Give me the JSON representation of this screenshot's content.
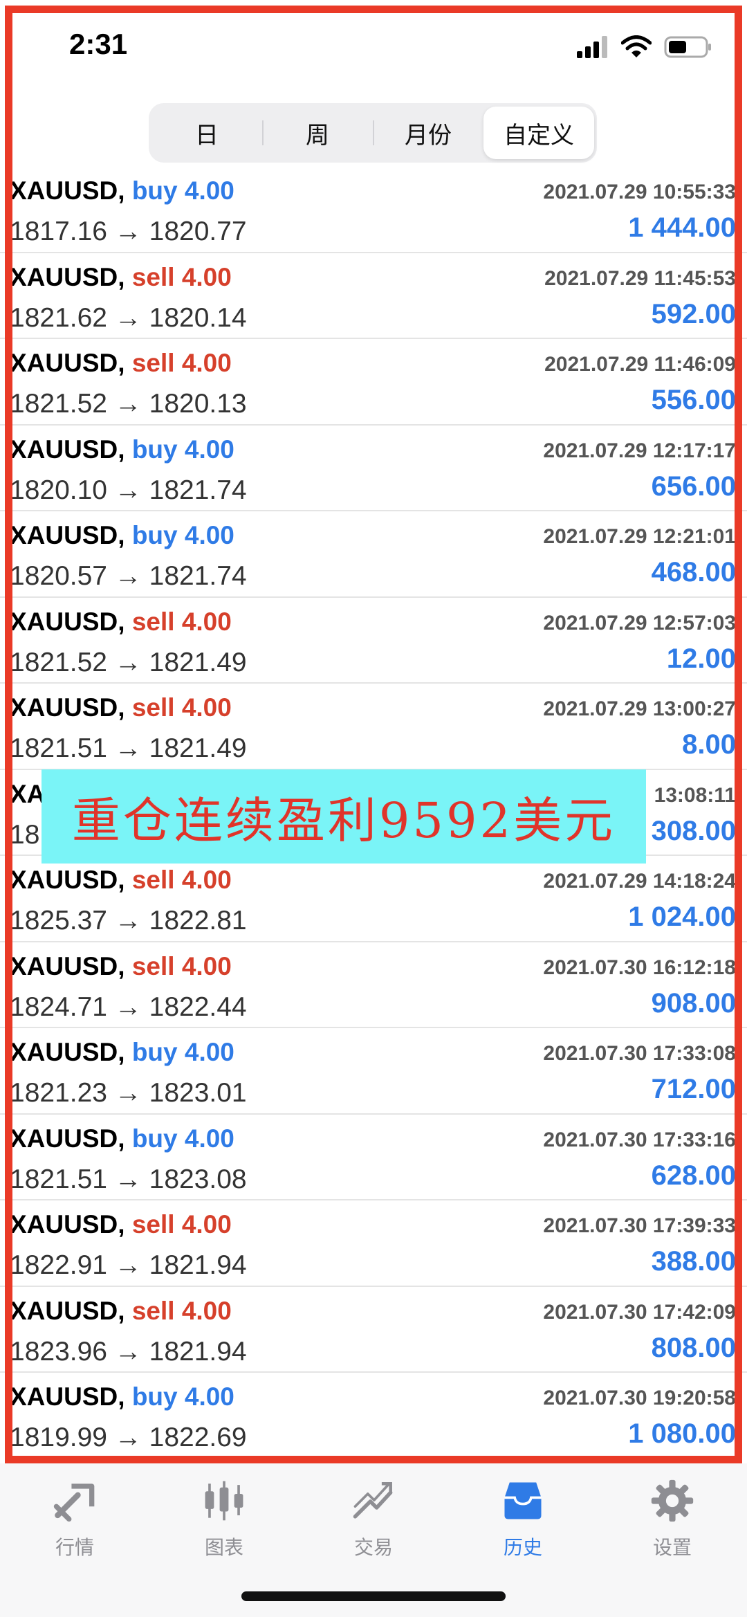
{
  "status": {
    "time": "2:31"
  },
  "segments": [
    {
      "label": "日",
      "active": false
    },
    {
      "label": "周",
      "active": false
    },
    {
      "label": "月份",
      "active": false
    },
    {
      "label": "自定义",
      "active": true
    }
  ],
  "trades": [
    {
      "symbol": "XAUUSD",
      "side": "buy",
      "volume": "4.00",
      "prices": "1817.16 → 1820.77",
      "time": "2021.07.29 10:55:33",
      "profit": "1 444.00"
    },
    {
      "symbol": "XAUUSD",
      "side": "sell",
      "volume": "4.00",
      "prices": "1821.62 → 1820.14",
      "time": "2021.07.29 11:45:53",
      "profit": "592.00"
    },
    {
      "symbol": "XAUUSD",
      "side": "sell",
      "volume": "4.00",
      "prices": "1821.52 → 1820.13",
      "time": "2021.07.29 11:46:09",
      "profit": "556.00"
    },
    {
      "symbol": "XAUUSD",
      "side": "buy",
      "volume": "4.00",
      "prices": "1820.10 → 1821.74",
      "time": "2021.07.29 12:17:17",
      "profit": "656.00"
    },
    {
      "symbol": "XAUUSD",
      "side": "buy",
      "volume": "4.00",
      "prices": "1820.57 → 1821.74",
      "time": "2021.07.29 12:21:01",
      "profit": "468.00"
    },
    {
      "symbol": "XAUUSD",
      "side": "sell",
      "volume": "4.00",
      "prices": "1821.52 → 1821.49",
      "time": "2021.07.29 12:57:03",
      "profit": "12.00"
    },
    {
      "symbol": "XAUUSD",
      "side": "sell",
      "volume": "4.00",
      "prices": "1821.51 → 1821.49",
      "time": "2021.07.29 13:00:27",
      "profit": "8.00"
    },
    {
      "symbol": "XA",
      "side": "",
      "volume": "",
      "prices": "18",
      "time": "13:08:11",
      "profit": "308.00"
    },
    {
      "symbol": "XAUUSD",
      "side": "sell",
      "volume": "4.00",
      "prices": "1825.37 → 1822.81",
      "time": "2021.07.29 14:18:24",
      "profit": "1 024.00"
    },
    {
      "symbol": "XAUUSD",
      "side": "sell",
      "volume": "4.00",
      "prices": "1824.71 → 1822.44",
      "time": "2021.07.30 16:12:18",
      "profit": "908.00"
    },
    {
      "symbol": "XAUUSD",
      "side": "buy",
      "volume": "4.00",
      "prices": "1821.23 → 1823.01",
      "time": "2021.07.30 17:33:08",
      "profit": "712.00"
    },
    {
      "symbol": "XAUUSD",
      "side": "buy",
      "volume": "4.00",
      "prices": "1821.51 → 1823.08",
      "time": "2021.07.30 17:33:16",
      "profit": "628.00"
    },
    {
      "symbol": "XAUUSD",
      "side": "sell",
      "volume": "4.00",
      "prices": "1822.91 → 1821.94",
      "time": "2021.07.30 17:39:33",
      "profit": "388.00"
    },
    {
      "symbol": "XAUUSD",
      "side": "sell",
      "volume": "4.00",
      "prices": "1823.96 → 1821.94",
      "time": "2021.07.30 17:42:09",
      "profit": "808.00"
    },
    {
      "symbol": "XAUUSD",
      "side": "buy",
      "volume": "4.00",
      "prices": "1819.99 → 1822.69",
      "time": "2021.07.30 19:20:58",
      "profit": "1 080.00"
    }
  ],
  "overlay": {
    "text": "重仓连续盈利9592美元"
  },
  "tabs": [
    {
      "label": "行情",
      "icon": "quotes-icon",
      "active": false
    },
    {
      "label": "图表",
      "icon": "chart-candles-icon",
      "active": false
    },
    {
      "label": "交易",
      "icon": "trade-icon",
      "active": false
    },
    {
      "label": "历史",
      "icon": "history-inbox-icon",
      "active": true
    },
    {
      "label": "设置",
      "icon": "gear-icon",
      "active": false
    }
  ],
  "colors": {
    "buy": "#2f7be6",
    "sell": "#d6402b",
    "profit": "#2f7be6",
    "frame": "#ea3a27",
    "overlay_bg": "#7af4f7",
    "overlay_text": "#e0342a",
    "tab_active": "#2f7be6",
    "tab_inactive": "#8e8e93"
  }
}
